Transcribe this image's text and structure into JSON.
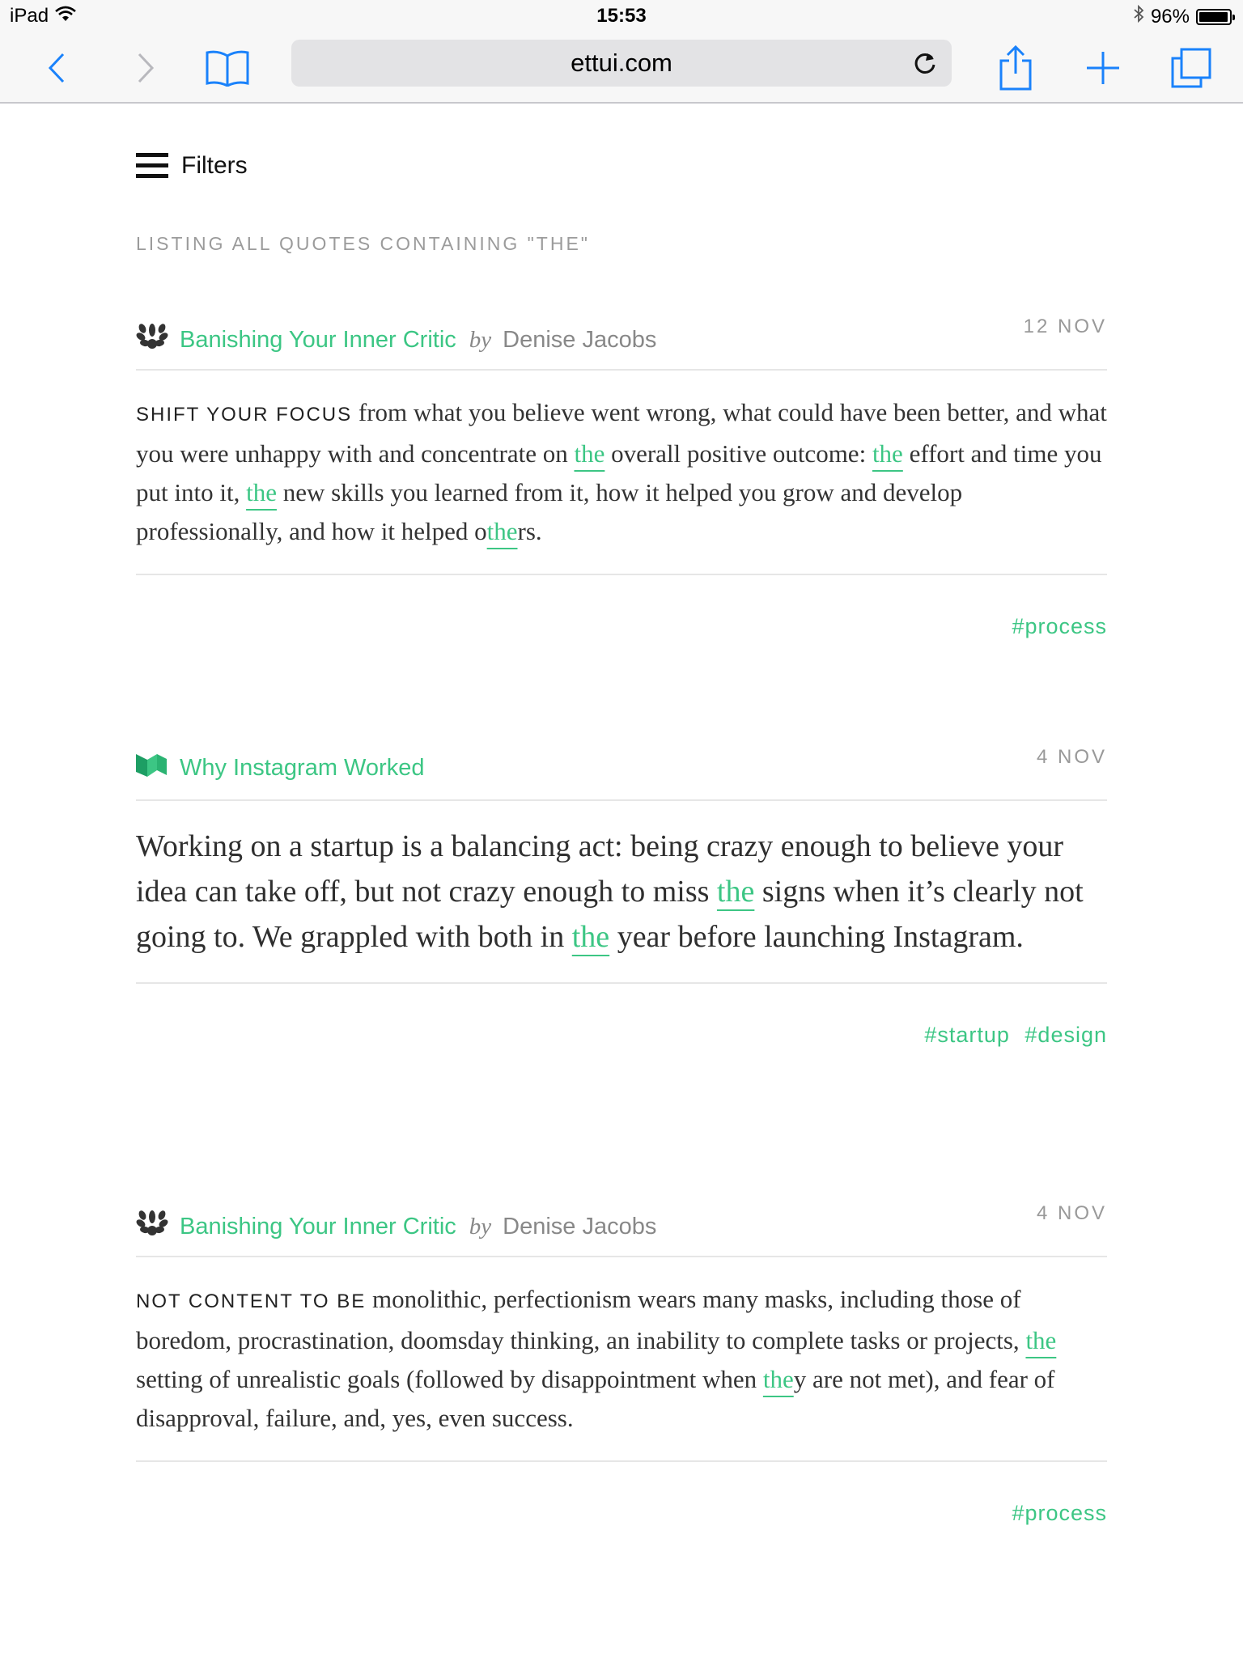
{
  "status_bar": {
    "device": "iPad",
    "time": "15:53",
    "battery": "96%",
    "battery_level": 0.96
  },
  "browser": {
    "url": "ettui.com",
    "icons": {
      "back": "chevron-left-icon",
      "forward": "chevron-right-icon",
      "bookmarks": "book-icon",
      "reload": "reload-icon",
      "share": "share-icon",
      "new_tab": "plus-icon",
      "tabs": "tabs-icon"
    },
    "accent": "#1a82fb"
  },
  "page": {
    "filters_label": "Filters",
    "listing_heading": "LISTING ALL QUOTES CONTAINING \"THE\"",
    "accent_color": "#3cc684"
  },
  "quotes": [
    {
      "source_icon": "laurel-icon",
      "title": "Banishing Your Inner Critic",
      "by": "by",
      "author": "Denise Jacobs",
      "date": "12 NOV",
      "lead": "SHIFT YOUR FOCUS",
      "segments": [
        " from what you believe went wrong, what could have been better, and what you were unhappy with and concentrate on ",
        "the",
        " overall positive outcome: ",
        "the",
        " effort and time you put into it, ",
        "the",
        " new skills you learned from it, how it helped you grow and develop professionally, and how it helped o",
        "the",
        "rs."
      ],
      "tags": [
        "#process"
      ]
    },
    {
      "source_icon": "medium-icon",
      "title": "Why Instagram Worked",
      "date": "4 NOV",
      "segments": [
        "Working on a startup is a balancing act: being crazy enough to believe your idea can take off, but not crazy enough to miss ",
        "the",
        " signs when it’s clearly not going to. We grappled with both in ",
        "the",
        " year before launching Instagram."
      ],
      "tags": [
        "#startup",
        "#design"
      ]
    },
    {
      "source_icon": "laurel-icon",
      "title": "Banishing Your Inner Critic",
      "by": "by",
      "author": "Denise Jacobs",
      "date": "4 NOV",
      "lead": "NOT CONTENT TO BE",
      "segments": [
        " monolithic, perfectionism wears many masks, including those of boredom, procrastination, doomsday thinking, an inability to complete tasks or projects, ",
        "the",
        " setting of unrealistic goals (followed by disappointment when ",
        "the",
        "y are not met), and fear of disapproval, failure, and, yes, even success."
      ],
      "tags": [
        "#process"
      ]
    }
  ]
}
